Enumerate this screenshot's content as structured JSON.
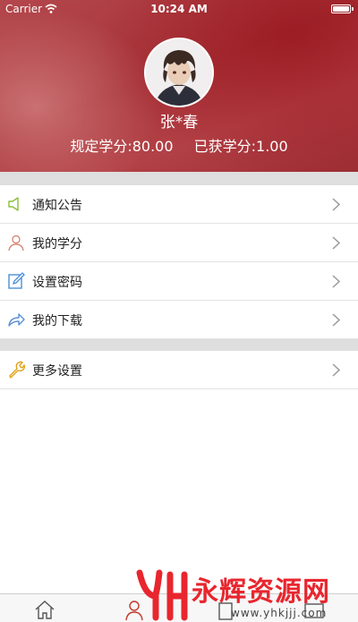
{
  "status_bar": {
    "carrier": "Carrier",
    "time": "10:24 AM"
  },
  "profile": {
    "name": "张*春",
    "required_credits": "规定学分:80.00",
    "earned_credits": "已获学分:1.00"
  },
  "menu": {
    "group1": [
      {
        "label": "通知公告",
        "icon": "speaker-icon"
      },
      {
        "label": "我的学分",
        "icon": "user-icon"
      },
      {
        "label": "设置密码",
        "icon": "edit-icon"
      },
      {
        "label": "我的下载",
        "icon": "share-icon"
      }
    ],
    "group2": [
      {
        "label": "更多设置",
        "icon": "wrench-icon"
      }
    ]
  },
  "tab_bar": {
    "tabs": [
      {
        "icon": "home-icon",
        "active": false
      },
      {
        "icon": "user-icon",
        "active": true
      },
      {
        "icon": "tab3-icon",
        "active": false
      },
      {
        "icon": "tab4-icon",
        "active": false
      }
    ]
  },
  "watermark": {
    "text": "永辉资源网",
    "url": "www.yhkjjj.com",
    "color": "#e8262e"
  },
  "colors": {
    "header": "#a63338",
    "separator": "#dedede",
    "chevron": "#9a9a9a",
    "tab_active": "#c0392b"
  }
}
